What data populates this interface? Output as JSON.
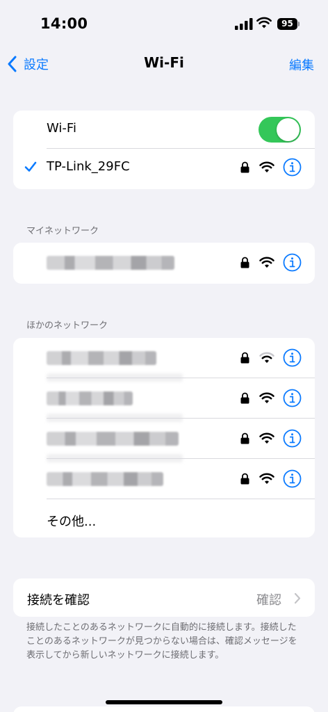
{
  "status_bar": {
    "time": "14:00",
    "battery": "95"
  },
  "nav": {
    "back_label": "設定",
    "title": "Wi-Fi",
    "edit_label": "編集"
  },
  "wifi_group": {
    "toggle_label": "Wi-Fi",
    "toggle_on": true,
    "connected_network": "TP-Link_29FC"
  },
  "my_networks": {
    "header": "マイネットワーク"
  },
  "other_networks": {
    "header": "ほかのネットワーク",
    "other_label": "その他..."
  },
  "ask_to_join": {
    "label": "接続を確認",
    "value": "確認",
    "footer": "接続したことのあるネットワークに自動的に接続します。接続したことのあるネットワークが見つからない場合は、確認メッセージを表示してから新しいネットワークに接続します。"
  },
  "colors": {
    "accent": "#0a7aff",
    "toggle_on": "#34c759",
    "background": "#f2f2f7"
  },
  "icons": [
    "chevron-left-icon",
    "checkmark-icon",
    "lock-icon",
    "wifi-icon",
    "info-icon",
    "chevron-right-icon",
    "cellular-signal-icon",
    "battery-icon"
  ]
}
